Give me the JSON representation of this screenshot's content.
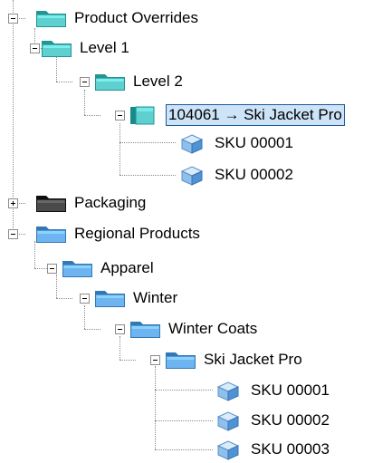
{
  "tree": {
    "product_overrides": {
      "label": "Product Overrides",
      "icon": "folder-teal-icon",
      "children": {
        "level1": {
          "label": "Level 1",
          "icon": "folder-teal-icon",
          "children": {
            "level2": {
              "label": "Level 2",
              "icon": "folder-teal-icon",
              "children": {
                "override_item": {
                  "label": "104061 → Ski Jacket Pro",
                  "icon": "cube-teal-icon",
                  "selected": true,
                  "children": [
                    {
                      "label": "SKU 00001",
                      "icon": "sku-cube-icon"
                    },
                    {
                      "label": "SKU 00002",
                      "icon": "sku-cube-icon"
                    }
                  ]
                }
              }
            }
          }
        }
      }
    },
    "packaging": {
      "label": "Packaging",
      "icon": "folder-dark-icon",
      "expanded": false
    },
    "regional_products": {
      "label": "Regional Products",
      "icon": "folder-blue-icon",
      "children": {
        "apparel": {
          "label": "Apparel",
          "icon": "folder-blue-icon",
          "children": {
            "winter": {
              "label": "Winter",
              "icon": "folder-blue-icon",
              "children": {
                "winter_coats": {
                  "label": "Winter Coats",
                  "icon": "folder-blue-icon",
                  "children": {
                    "ski_jacket": {
                      "label": "Ski Jacket Pro",
                      "icon": "folder-blue-icon",
                      "children": [
                        {
                          "label": "SKU 00001",
                          "icon": "sku-cube-icon"
                        },
                        {
                          "label": "SKU 00002",
                          "icon": "sku-cube-icon"
                        },
                        {
                          "label": "SKU 00003",
                          "icon": "sku-cube-icon"
                        }
                      ]
                    }
                  }
                }
              }
            }
          }
        }
      }
    }
  },
  "colors": {
    "folder_teal": "#5fd0d0",
    "folder_dark": "#4a4a4a",
    "folder_blue": "#6eb4f0",
    "selection_bg": "#cde3f7",
    "selection_border": "#1e5a99"
  }
}
